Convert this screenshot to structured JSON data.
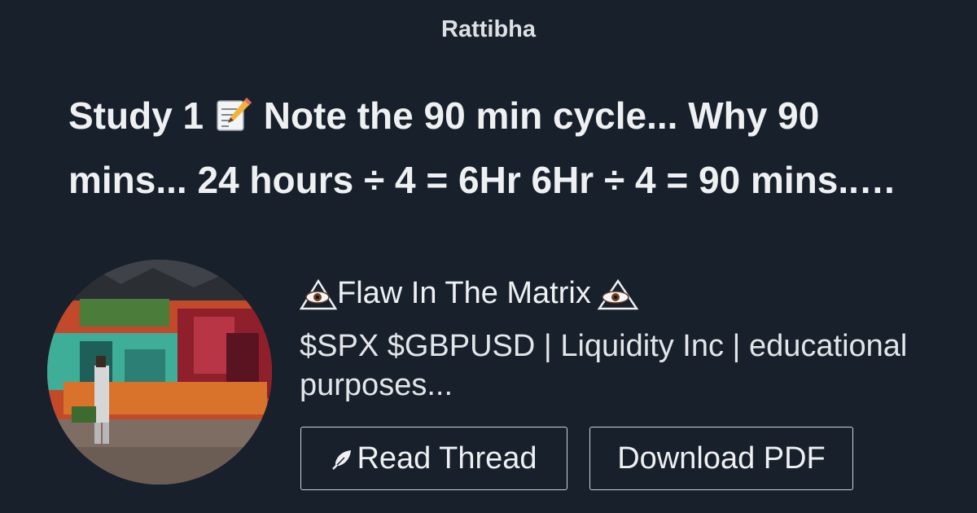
{
  "site": {
    "name": "Rattibha"
  },
  "thread": {
    "title_line1_part1": "Study 1",
    "title_line1_part2": "Note the 90 min cycle... Why 90",
    "title_line2": "mins... 24 hours ÷ 4 = 6Hr 6Hr ÷ 4 = 90 mins..…",
    "title_icon": "memo-icon"
  },
  "author": {
    "name": "Flaw In The Matrix",
    "name_icon": "eye-in-triangle-icon",
    "bio": "$SPX $GBPUSD | Liquidity Inc | educational purposes...",
    "avatar": "avatar-graffiti-photo"
  },
  "actions": {
    "read_label": "Read Thread",
    "read_icon": "feather-icon",
    "download_label": "Download PDF"
  },
  "colors": {
    "background": "#18202b",
    "text": "#eef0f2",
    "button_border": "#cfd3d8"
  }
}
